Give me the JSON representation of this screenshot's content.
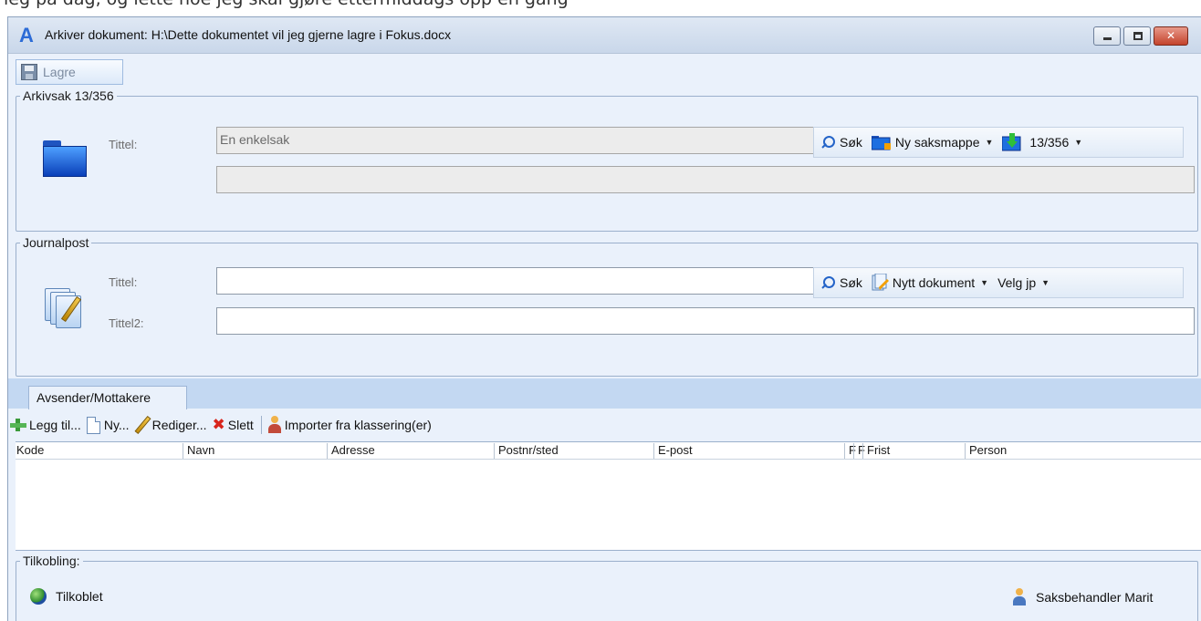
{
  "window": {
    "title": "Arkiver dokument: H:\\Dette dokumentet vil jeg gjerne lagre i Fokus.docx",
    "cut_text": "leg på dag, og lette noe jeg skal gjøre ettermiddags opp en gang"
  },
  "toolbar": {
    "save_label": "Lagre"
  },
  "arkivsak": {
    "legend": "Arkivsak 13/356",
    "title_label": "Tittel:",
    "title_value": "En enkelsak",
    "title2_value": "",
    "search_label": "Søk",
    "new_folder_label": "Ny saksmappe",
    "case_number": "13/356"
  },
  "journalpost": {
    "legend": "Journalpost",
    "title_label": "Tittel:",
    "title_value": "",
    "title2_label": "Tittel2:",
    "title2_value": "",
    "search_label": "Søk",
    "new_doc_label": "Nytt dokument",
    "select_label": "Velg jp"
  },
  "tabs": [
    {
      "label": "Avsender/Mottakere",
      "active": true
    }
  ],
  "recipients_toolbar": {
    "add": "Legg til...",
    "new": "Ny...",
    "edit": "Rediger...",
    "delete": "Slett",
    "import": "Importer fra klassering(er)"
  },
  "grid": {
    "columns": [
      "Kode",
      "Navn",
      "Adresse",
      "Postnr/sted",
      "E-post",
      "F",
      "F",
      "Frist",
      "Person"
    ],
    "rows": []
  },
  "connection": {
    "legend": "Tilkobling:",
    "status": "Tilkoblet",
    "user": "Saksbehandler Marit"
  },
  "icons": [
    "app-logo-icon",
    "minimize-icon",
    "maximize-icon",
    "close-icon",
    "save-icon",
    "folder-icon",
    "document-icon",
    "search-icon",
    "new-folder-icon",
    "case-import-icon",
    "new-document-icon",
    "add-icon",
    "new-page-icon",
    "pencil-icon",
    "delete-icon",
    "import-person-icon",
    "globe-icon",
    "user-icon"
  ],
  "colors": {
    "accent": "#2464c8",
    "window_bg": "#eaf1fb",
    "tab_strip": "#c3d8f2",
    "close_button": "#c4432c"
  }
}
